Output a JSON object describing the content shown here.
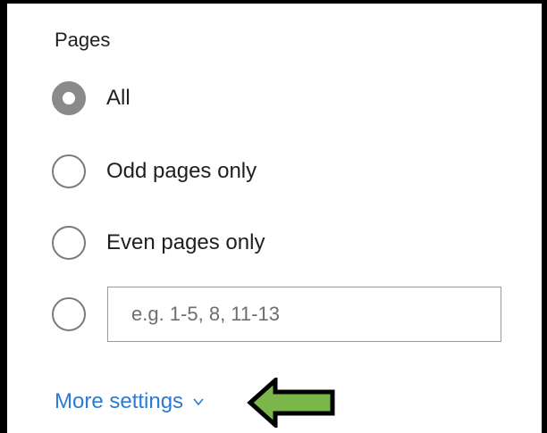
{
  "pages": {
    "title": "Pages",
    "options": [
      {
        "label": "All",
        "selected": true
      },
      {
        "label": "Odd pages only",
        "selected": false
      },
      {
        "label": "Even pages only",
        "selected": false
      }
    ],
    "custom_range": {
      "selected": false,
      "placeholder": "e.g. 1-5, 8, 11-13",
      "value": ""
    },
    "more_settings_label": "More settings",
    "annotation_arrow": {
      "color": "#7ab648",
      "outline": "#000000",
      "direction": "left"
    }
  },
  "colors": {
    "link": "#2b7bd6",
    "text": "#1f1f1f",
    "radio_selected": "#8a8a8a"
  }
}
